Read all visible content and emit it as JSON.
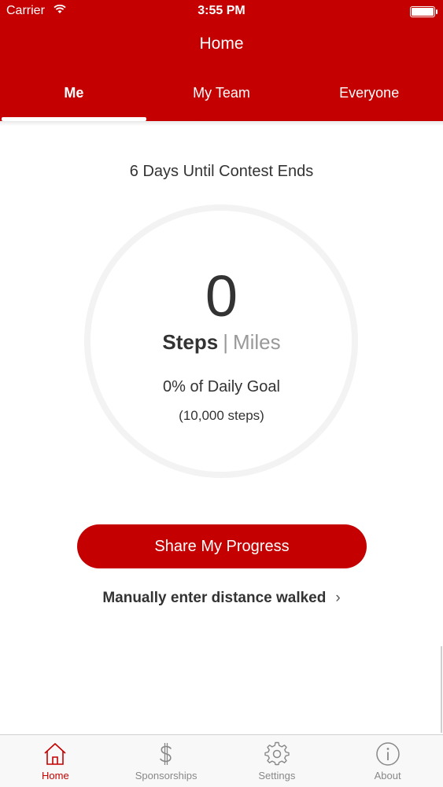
{
  "status_bar": {
    "carrier": "Carrier",
    "time": "3:55 PM",
    "battery_level": 1.0
  },
  "nav": {
    "title": "Home"
  },
  "tabs": [
    {
      "label": "Me",
      "active": true
    },
    {
      "label": "My Team",
      "active": false
    },
    {
      "label": "Everyone",
      "active": false
    }
  ],
  "contest": {
    "countdown": "6 Days Until Contest Ends"
  },
  "progress": {
    "value": "0",
    "unit_active": "Steps",
    "separator": "|",
    "unit_alt": "Miles",
    "goal_percent": "0% of Daily Goal",
    "goal_steps": "(10,000 steps)"
  },
  "actions": {
    "share_label": "Share My Progress",
    "manual_label": "Manually enter distance walked",
    "manual_chevron": "›"
  },
  "tabbar": [
    {
      "label": "Home",
      "icon": "home-icon",
      "active": true
    },
    {
      "label": "Sponsorships",
      "icon": "dollar-icon",
      "active": false
    },
    {
      "label": "Settings",
      "icon": "gear-icon",
      "active": false
    },
    {
      "label": "About",
      "icon": "info-icon",
      "active": false
    }
  ],
  "colors": {
    "accent": "#c40000",
    "text": "#333333",
    "muted": "#999999",
    "tab_inactive": "#888888"
  }
}
